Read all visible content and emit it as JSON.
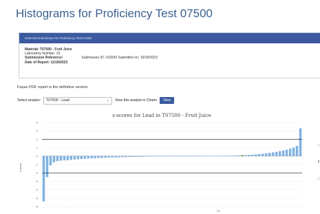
{
  "page": {
    "title": "Histograms for Proficiency Test 07500"
  },
  "submission": {
    "header": "Selected Submission for Proficiency Test 07500",
    "material": "Material: T07500 - Fruit Juice",
    "lab_number": "Laboratory Number: 23",
    "submission_ref_label": "Submission Reference:",
    "submission_id": "Submission ID: 103034",
    "submitted_on": "Submitted on: 10/18/2023",
    "report_date": "Date of Report: 11/18/2023"
  },
  "notice": "Fapas PDF report is the definitive version",
  "analyte": {
    "label": "Select analyte:",
    "selected": "T07500 - Lead",
    "chevron_icon": "chevron-down-icon",
    "view_label": "View this analyte in Charts",
    "view_button": "View"
  },
  "chart_data": {
    "type": "bar",
    "title": "z-scores for Lead in T07500 - Fruit Juice",
    "ylabel": "z-score",
    "xlabel": "",
    "ylim": [
      -6,
      4
    ],
    "yticks": [
      "4",
      "3",
      "2",
      "1",
      "0",
      "-1",
      "-2",
      "-3",
      "-4",
      "-5",
      "-6"
    ],
    "reference_lines": [
      2,
      -2
    ],
    "x_tick_label": "23",
    "highlight_index": 58,
    "bar_color": "#7fb2e2",
    "highlight_color": "#3a8a3a",
    "values": [
      -5.4,
      -2.5,
      -1.1,
      -0.75,
      -0.6,
      -0.55,
      -0.5,
      -0.5,
      -0.45,
      -0.4,
      -0.38,
      -0.35,
      -0.32,
      -0.3,
      -0.28,
      -0.26,
      -0.24,
      -0.22,
      -0.2,
      -0.18,
      -0.17,
      -0.16,
      -0.15,
      -0.14,
      -0.13,
      -0.12,
      -0.11,
      -0.1,
      -0.09,
      -0.08,
      -0.07,
      -0.06,
      -0.05,
      -0.05,
      -0.04,
      -0.03,
      -0.02,
      -0.02,
      -0.01,
      -0.01,
      0.0,
      0.0,
      0.0,
      0.0,
      0.0,
      0.0,
      0.01,
      0.01,
      0.02,
      0.02,
      0.03,
      0.03,
      0.04,
      0.04,
      0.05,
      0.06,
      0.07,
      0.08,
      0.1,
      0.12,
      0.14,
      0.16,
      0.2,
      0.24,
      0.28,
      0.33,
      0.38,
      0.44,
      0.5,
      0.58,
      0.66,
      0.76,
      0.88,
      1.0,
      1.2,
      3.3
    ]
  }
}
